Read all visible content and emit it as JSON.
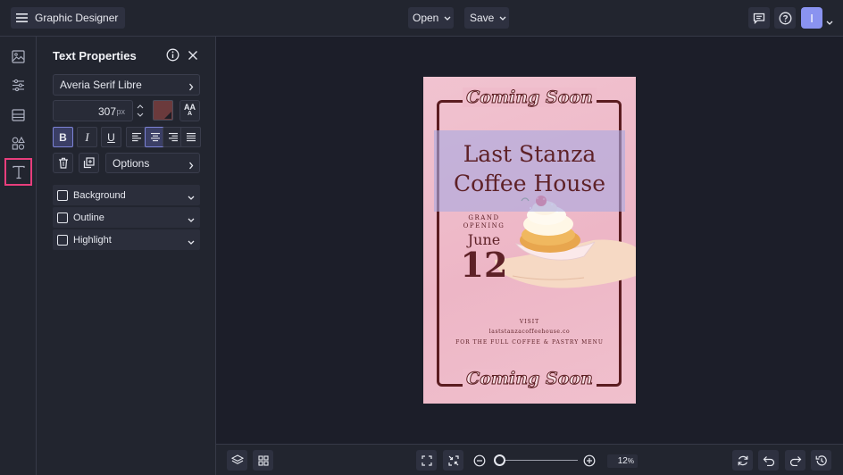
{
  "app": {
    "title": "Graphic Designer",
    "menu_icon": "hamburger-menu-icon"
  },
  "header": {
    "open_label": "Open",
    "save_label": "Save",
    "avatar_initial": "I"
  },
  "panel": {
    "title": "Text Properties",
    "font_name": "Averia Serif Libre",
    "font_size": "307",
    "font_size_unit": "px",
    "text_color": "#6b3a3c",
    "case_label_top": "AA",
    "case_label_bottom": "A",
    "bold_label": "B",
    "italic_label": "I",
    "underline_label": "U",
    "options_label": "Options",
    "sections": [
      {
        "label": "Background"
      },
      {
        "label": "Outline"
      },
      {
        "label": "Highlight"
      }
    ]
  },
  "poster": {
    "coming_soon_top": "Coming Soon",
    "headline_line1": "Last Stanza",
    "headline_line2": "Coffee House",
    "grand": "GRAND",
    "opening": "OPENING",
    "month": "June",
    "day": "12",
    "visit": "VISIT",
    "website": "laststanzacoffeehouse.co",
    "menu_line": "FOR THE FULL COFFEE & PASTRY MENU",
    "coming_soon_bottom": "Coming Soon"
  },
  "zoom": {
    "value": "12",
    "unit": "%"
  },
  "colors": {
    "accent": "#e83e7c",
    "active_format": "#7c83d6",
    "poster_text": "#5e2127",
    "poster_bg": "#efbccb"
  }
}
